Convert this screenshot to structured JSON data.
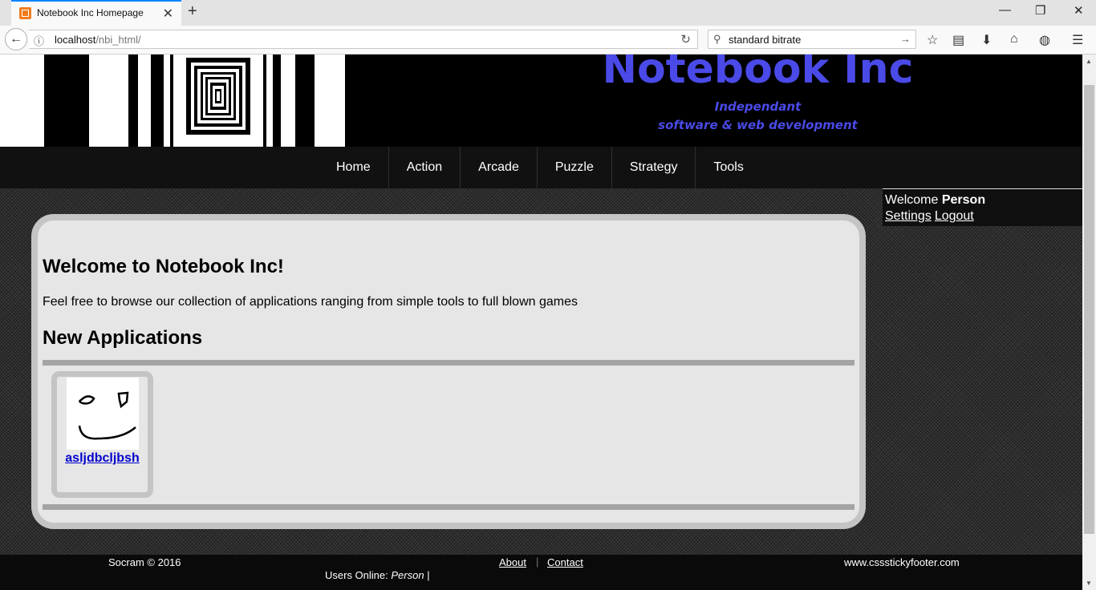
{
  "browser": {
    "tab_title": "Notebook Inc Homepage",
    "url_host": "localhost",
    "url_path": "/nbi_html/",
    "search_query": "standard bitrate"
  },
  "header": {
    "brand_name": "Notebook Inc",
    "tagline_line1": "Independant",
    "tagline_line2": "software & web development"
  },
  "nav": {
    "items": [
      {
        "label": "Home"
      },
      {
        "label": "Action"
      },
      {
        "label": "Arcade"
      },
      {
        "label": "Puzzle"
      },
      {
        "label": "Strategy"
      },
      {
        "label": "Tools"
      }
    ]
  },
  "user_panel": {
    "welcome_prefix": "Welcome",
    "username": "Person",
    "settings_link": "Settings",
    "logout_link": "Logout"
  },
  "main": {
    "heading": "Welcome to Notebook Inc!",
    "intro": "Feel free to browse our collection of applications ranging from simple tools to full blown games",
    "new_apps_heading": "New Applications",
    "apps": [
      {
        "name": "asljdbcljbsh"
      }
    ]
  },
  "footer": {
    "copyright": "Socram © 2016",
    "about": "About",
    "separator": "|",
    "contact": "Contact",
    "site": "www.cssstickyfooter.com",
    "users_online_label": "Users Online:",
    "users_online_name": "Person",
    "users_online_trailer": "|"
  },
  "colors": {
    "brand": "#4a4ae8",
    "link": "#0000cc",
    "tab_accent": "#0a84ff"
  }
}
